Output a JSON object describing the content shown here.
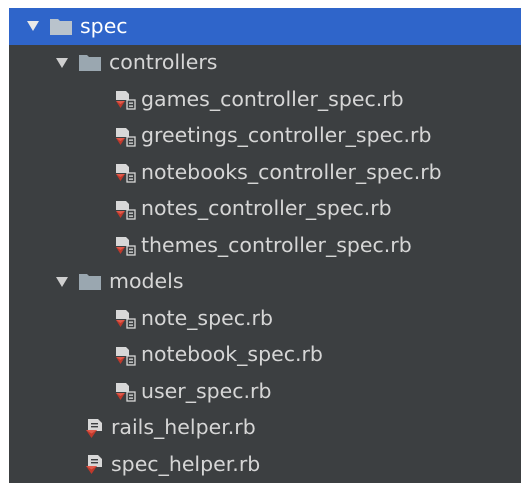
{
  "tree": {
    "root": {
      "label": "spec",
      "expanded": true,
      "selected": true,
      "icon": "folder-icon"
    },
    "controllers": {
      "label": "controllers",
      "icon": "folder-icon",
      "files": [
        {
          "label": "games_controller_spec.rb",
          "icon": "ruby-test-file-icon"
        },
        {
          "label": "greetings_controller_spec.rb",
          "icon": "ruby-test-file-icon"
        },
        {
          "label": "notebooks_controller_spec.rb",
          "icon": "ruby-test-file-icon"
        },
        {
          "label": "notes_controller_spec.rb",
          "icon": "ruby-test-file-icon"
        },
        {
          "label": "themes_controller_spec.rb",
          "icon": "ruby-test-file-icon"
        }
      ]
    },
    "models": {
      "label": "models",
      "icon": "folder-icon",
      "files": [
        {
          "label": "note_spec.rb",
          "icon": "ruby-test-file-icon"
        },
        {
          "label": "notebook_spec.rb",
          "icon": "ruby-test-file-icon"
        },
        {
          "label": "user_spec.rb",
          "icon": "ruby-test-file-icon"
        }
      ]
    },
    "root_files": [
      {
        "label": "rails_helper.rb",
        "icon": "ruby-file-icon"
      },
      {
        "label": "spec_helper.rb",
        "icon": "ruby-file-icon"
      }
    ]
  },
  "colors": {
    "panel_bg": "#3c3f41",
    "selection": "#2f65ca",
    "text": "#d6d6d6",
    "folder": "#9aa7b0",
    "ruby_red": "#c0392b"
  }
}
